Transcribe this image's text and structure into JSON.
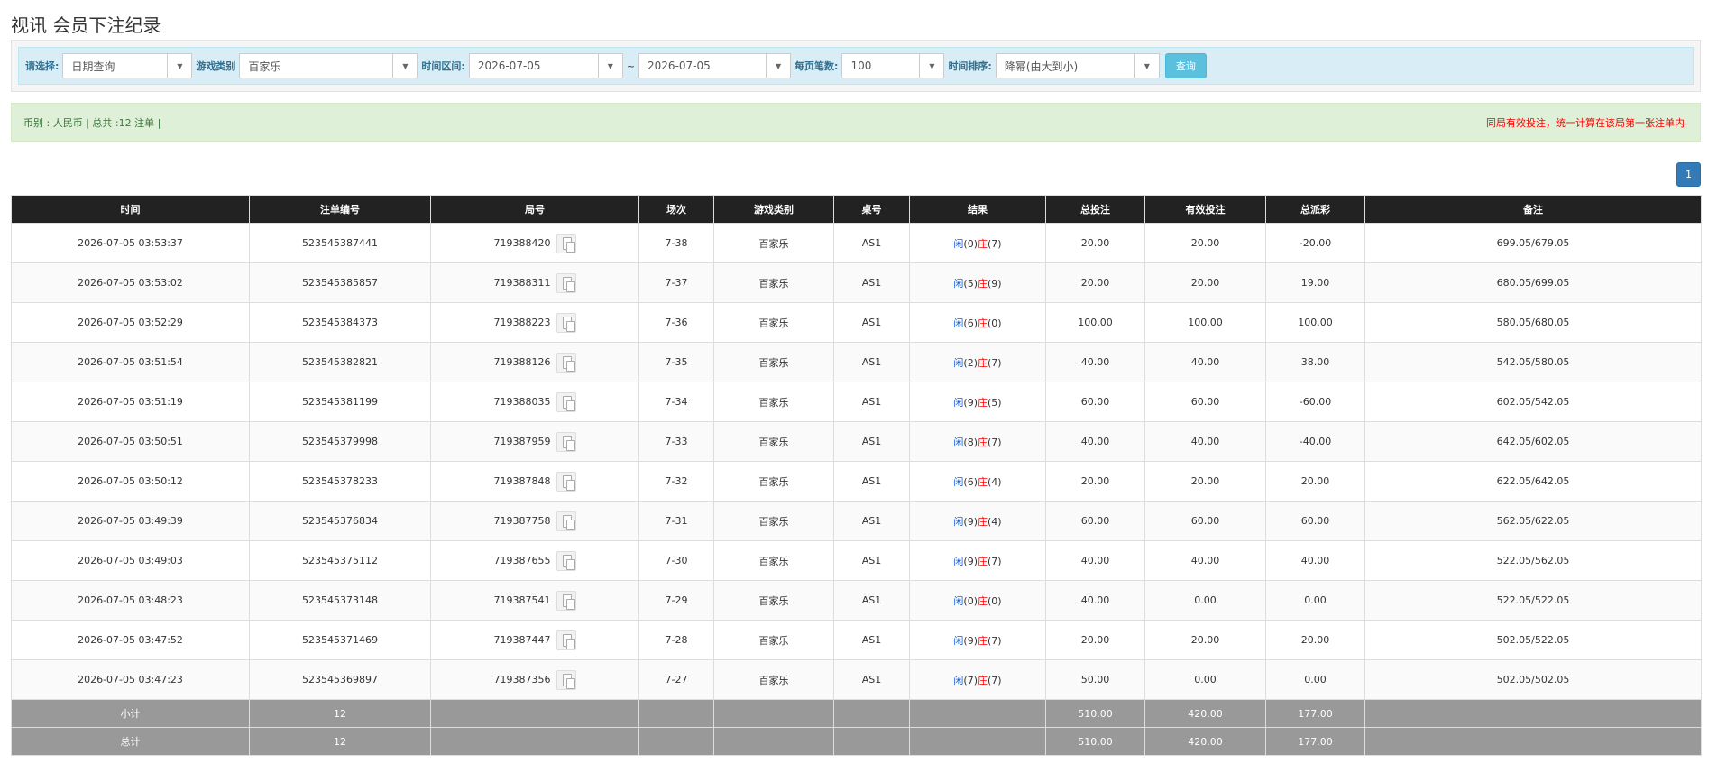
{
  "page": {
    "title": "视讯 会员下注纪录"
  },
  "filter": {
    "select_label": "请选择:",
    "select_value": "日期查询",
    "game_label": "游戏类别",
    "game_value": "百家乐",
    "range_label": "时间区间:",
    "start_date": "2026-07-05",
    "range_sep": "~",
    "end_date": "2026-07-05",
    "per_page_label": "每页笔数:",
    "per_page_value": "100",
    "sort_label": "时间排序:",
    "sort_value": "降幂(由大到小)",
    "query_button": "查询"
  },
  "info": {
    "summary": "币别 : 人民币 | 总共 :12 注单 |",
    "note": "同局有效投注，统一计算在该局第一张注单内"
  },
  "pagination": {
    "current": "1"
  },
  "colors": {
    "win": "#1a5fd6",
    "loss": "#ff0000",
    "header_bg": "#222222",
    "footer_bg": "#999999"
  },
  "table": {
    "columns": [
      "时间",
      "注单编号",
      "局号",
      "场次",
      "游戏类别",
      "桌号",
      "结果",
      "总投注",
      "有效投注",
      "总派彩",
      "备注"
    ],
    "rows": [
      {
        "time": "2026-07-05 03:53:37",
        "order": "523545387441",
        "round": "719388420",
        "session": "7-38",
        "game": "百家乐",
        "table": "AS1",
        "player_label": "闲",
        "player_val": "(0)",
        "banker_label": "庄",
        "banker_val": "(7)",
        "total_bet": "20.00",
        "valid_bet": "20.00",
        "payout": "-20.00",
        "payout_neg": true,
        "remark": "699.05/679.05"
      },
      {
        "time": "2026-07-05 03:53:02",
        "order": "523545385857",
        "round": "719388311",
        "session": "7-37",
        "game": "百家乐",
        "table": "AS1",
        "player_label": "闲",
        "player_val": "(5)",
        "banker_label": "庄",
        "banker_val": "(9)",
        "total_bet": "20.00",
        "valid_bet": "20.00",
        "payout": "19.00",
        "payout_neg": false,
        "remark": "680.05/699.05"
      },
      {
        "time": "2026-07-05 03:52:29",
        "order": "523545384373",
        "round": "719388223",
        "session": "7-36",
        "game": "百家乐",
        "table": "AS1",
        "player_label": "闲",
        "player_val": "(6)",
        "banker_label": "庄",
        "banker_val": "(0)",
        "total_bet": "100.00",
        "valid_bet": "100.00",
        "payout": "100.00",
        "payout_neg": false,
        "remark": "580.05/680.05"
      },
      {
        "time": "2026-07-05 03:51:54",
        "order": "523545382821",
        "round": "719388126",
        "session": "7-35",
        "game": "百家乐",
        "table": "AS1",
        "player_label": "闲",
        "player_val": "(2)",
        "banker_label": "庄",
        "banker_val": "(7)",
        "total_bet": "40.00",
        "valid_bet": "40.00",
        "payout": "38.00",
        "payout_neg": false,
        "remark": "542.05/580.05"
      },
      {
        "time": "2026-07-05 03:51:19",
        "order": "523545381199",
        "round": "719388035",
        "session": "7-34",
        "game": "百家乐",
        "table": "AS1",
        "player_label": "闲",
        "player_val": "(9)",
        "banker_label": "庄",
        "banker_val": "(5)",
        "total_bet": "60.00",
        "valid_bet": "60.00",
        "payout": "-60.00",
        "payout_neg": true,
        "remark": "602.05/542.05"
      },
      {
        "time": "2026-07-05 03:50:51",
        "order": "523545379998",
        "round": "719387959",
        "session": "7-33",
        "game": "百家乐",
        "table": "AS1",
        "player_label": "闲",
        "player_val": "(8)",
        "banker_label": "庄",
        "banker_val": "(7)",
        "total_bet": "40.00",
        "valid_bet": "40.00",
        "payout": "-40.00",
        "payout_neg": true,
        "remark": "642.05/602.05"
      },
      {
        "time": "2026-07-05 03:50:12",
        "order": "523545378233",
        "round": "719387848",
        "session": "7-32",
        "game": "百家乐",
        "table": "AS1",
        "player_label": "闲",
        "player_val": "(6)",
        "banker_label": "庄",
        "banker_val": "(4)",
        "total_bet": "20.00",
        "valid_bet": "20.00",
        "payout": "20.00",
        "payout_neg": false,
        "remark": "622.05/642.05"
      },
      {
        "time": "2026-07-05 03:49:39",
        "order": "523545376834",
        "round": "719387758",
        "session": "7-31",
        "game": "百家乐",
        "table": "AS1",
        "player_label": "闲",
        "player_val": "(9)",
        "banker_label": "庄",
        "banker_val": "(4)",
        "total_bet": "60.00",
        "valid_bet": "60.00",
        "payout": "60.00",
        "payout_neg": false,
        "remark": "562.05/622.05"
      },
      {
        "time": "2026-07-05 03:49:03",
        "order": "523545375112",
        "round": "719387655",
        "session": "7-30",
        "game": "百家乐",
        "table": "AS1",
        "player_label": "闲",
        "player_val": "(9)",
        "banker_label": "庄",
        "banker_val": "(7)",
        "total_bet": "40.00",
        "valid_bet": "40.00",
        "payout": "40.00",
        "payout_neg": false,
        "remark": "522.05/562.05"
      },
      {
        "time": "2026-07-05 03:48:23",
        "order": "523545373148",
        "round": "719387541",
        "session": "7-29",
        "game": "百家乐",
        "table": "AS1",
        "player_label": "闲",
        "player_val": "(0)",
        "banker_label": "庄",
        "banker_val": "(0)",
        "total_bet": "40.00",
        "valid_bet": "0.00",
        "payout": "0.00",
        "payout_neg": false,
        "remark": "522.05/522.05"
      },
      {
        "time": "2026-07-05 03:47:52",
        "order": "523545371469",
        "round": "719387447",
        "session": "7-28",
        "game": "百家乐",
        "table": "AS1",
        "player_label": "闲",
        "player_val": "(9)",
        "banker_label": "庄",
        "banker_val": "(7)",
        "total_bet": "20.00",
        "valid_bet": "20.00",
        "payout": "20.00",
        "payout_neg": false,
        "remark": "502.05/522.05"
      },
      {
        "time": "2026-07-05 03:47:23",
        "order": "523545369897",
        "round": "719387356",
        "session": "7-27",
        "game": "百家乐",
        "table": "AS1",
        "player_label": "闲",
        "player_val": "(7)",
        "banker_label": "庄",
        "banker_val": "(7)",
        "total_bet": "50.00",
        "valid_bet": "0.00",
        "payout": "0.00",
        "payout_neg": false,
        "remark": "502.05/502.05"
      }
    ],
    "subtotal": {
      "label": "小计",
      "count": "12",
      "total_bet": "510.00",
      "valid_bet": "420.00",
      "payout": "177.00"
    },
    "total": {
      "label": "总计",
      "count": "12",
      "total_bet": "510.00",
      "valid_bet": "420.00",
      "payout": "177.00"
    }
  }
}
